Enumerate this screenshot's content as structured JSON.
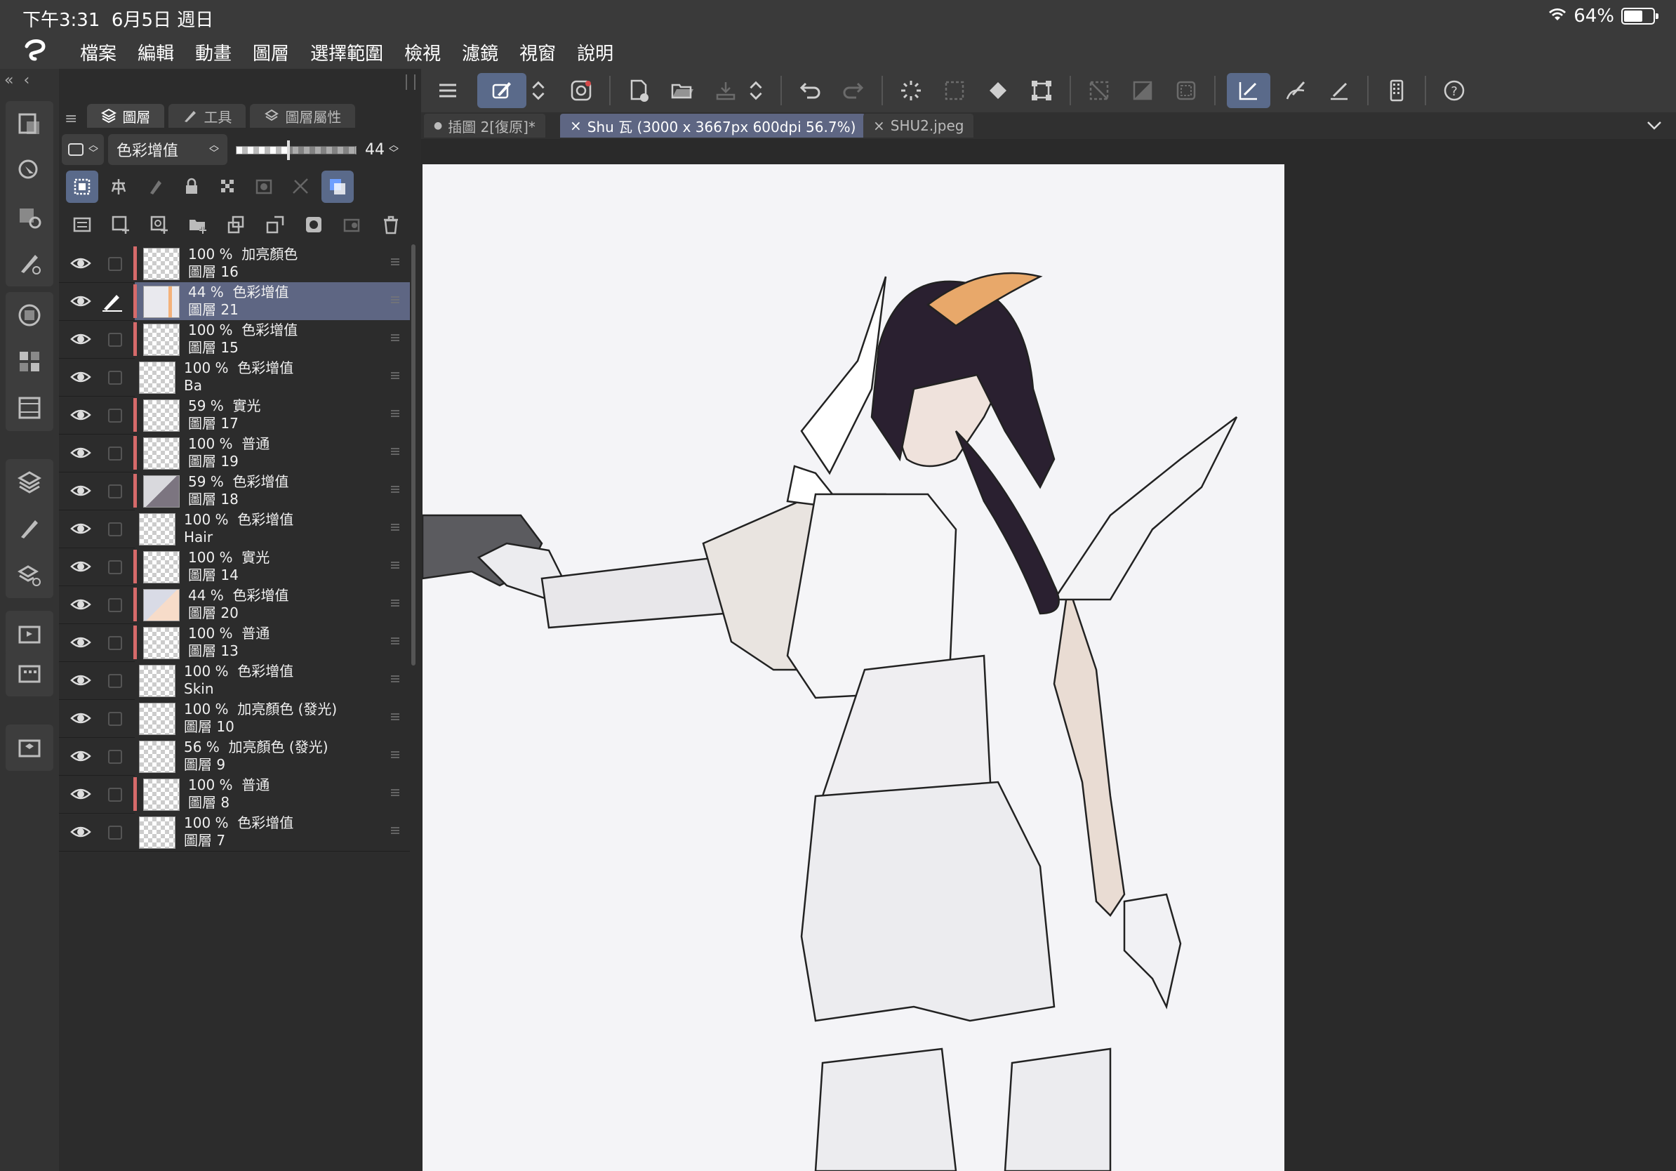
{
  "status": {
    "time": "下午3:31",
    "date": "6月5日 週日",
    "battery": "64%",
    "battery_level": 0.64
  },
  "menu": {
    "items": [
      "檔案",
      "編輯",
      "動畫",
      "圖層",
      "選擇範圍",
      "檢視",
      "濾鏡",
      "視窗",
      "說明"
    ]
  },
  "panel": {
    "tabs": [
      {
        "label": "圖層",
        "icon": "layers-icon"
      },
      {
        "label": "工具",
        "icon": "brush-icon"
      },
      {
        "label": "圖層屬性",
        "icon": "layer-property-icon"
      }
    ],
    "blend_mode": "色彩增值",
    "opacity": "44",
    "opacity_fraction": 0.44
  },
  "layers": [
    {
      "opacity": "100 %",
      "mode": "加亮顏色",
      "name": "圖層 16",
      "bar": true,
      "selected": false,
      "thumb": "checker"
    },
    {
      "opacity": "44 %",
      "mode": "色彩增值",
      "name": "圖層 21",
      "bar": true,
      "selected": true,
      "thumb": "peach-stripe"
    },
    {
      "opacity": "100 %",
      "mode": "色彩增值",
      "name": "圖層 15",
      "bar": true,
      "selected": false,
      "thumb": "checker"
    },
    {
      "opacity": "100 %",
      "mode": "色彩增值",
      "name": "Ba",
      "bar": false,
      "selected": false,
      "thumb": "checker"
    },
    {
      "opacity": "59 %",
      "mode": "實光",
      "name": "圖層 17",
      "bar": true,
      "selected": false,
      "thumb": "checker"
    },
    {
      "opacity": "100 %",
      "mode": "普通",
      "name": "圖層 19",
      "bar": true,
      "selected": false,
      "thumb": "checker"
    },
    {
      "opacity": "59 %",
      "mode": "色彩增值",
      "name": "圖層 18",
      "bar": true,
      "selected": false,
      "thumb": "grey-diagonal"
    },
    {
      "opacity": "100 %",
      "mode": "色彩增值",
      "name": "Hair",
      "bar": false,
      "selected": false,
      "thumb": "checker"
    },
    {
      "opacity": "100 %",
      "mode": "實光",
      "name": "圖層 14",
      "bar": true,
      "selected": false,
      "thumb": "checker"
    },
    {
      "opacity": "44 %",
      "mode": "色彩增值",
      "name": "圖層 20",
      "bar": true,
      "selected": false,
      "thumb": "peach-diagonal"
    },
    {
      "opacity": "100 %",
      "mode": "普通",
      "name": "圖層 13",
      "bar": true,
      "selected": false,
      "thumb": "checker"
    },
    {
      "opacity": "100 %",
      "mode": "色彩增值",
      "name": "Skin",
      "bar": false,
      "selected": false,
      "thumb": "checker"
    },
    {
      "opacity": "100 %",
      "mode": "加亮顏色 (發光)",
      "name": "圖層 10",
      "bar": false,
      "selected": false,
      "thumb": "checker"
    },
    {
      "opacity": "56 %",
      "mode": "加亮顏色 (發光)",
      "name": "圖層 9",
      "bar": false,
      "selected": false,
      "thumb": "checker"
    },
    {
      "opacity": "100 %",
      "mode": "普通",
      "name": "圖層 8",
      "bar": true,
      "selected": false,
      "thumb": "checker"
    },
    {
      "opacity": "100 %",
      "mode": "色彩增值",
      "name": "圖層 7",
      "bar": false,
      "selected": false,
      "thumb": "checker"
    }
  ],
  "doc_tabs": [
    {
      "label": "插圖 2[復原]*",
      "prefix": "●",
      "active": false
    },
    {
      "label": "Shu 瓦 (3000 x 3667px 600dpi 56.7%)",
      "prefix": "×",
      "active": true
    },
    {
      "label": "SHU2.jpeg",
      "prefix": "×",
      "active": false
    }
  ],
  "colors": {
    "accent": "#5e6683",
    "layer_bar": "#d66a6a",
    "background": "#2c2c2c"
  }
}
